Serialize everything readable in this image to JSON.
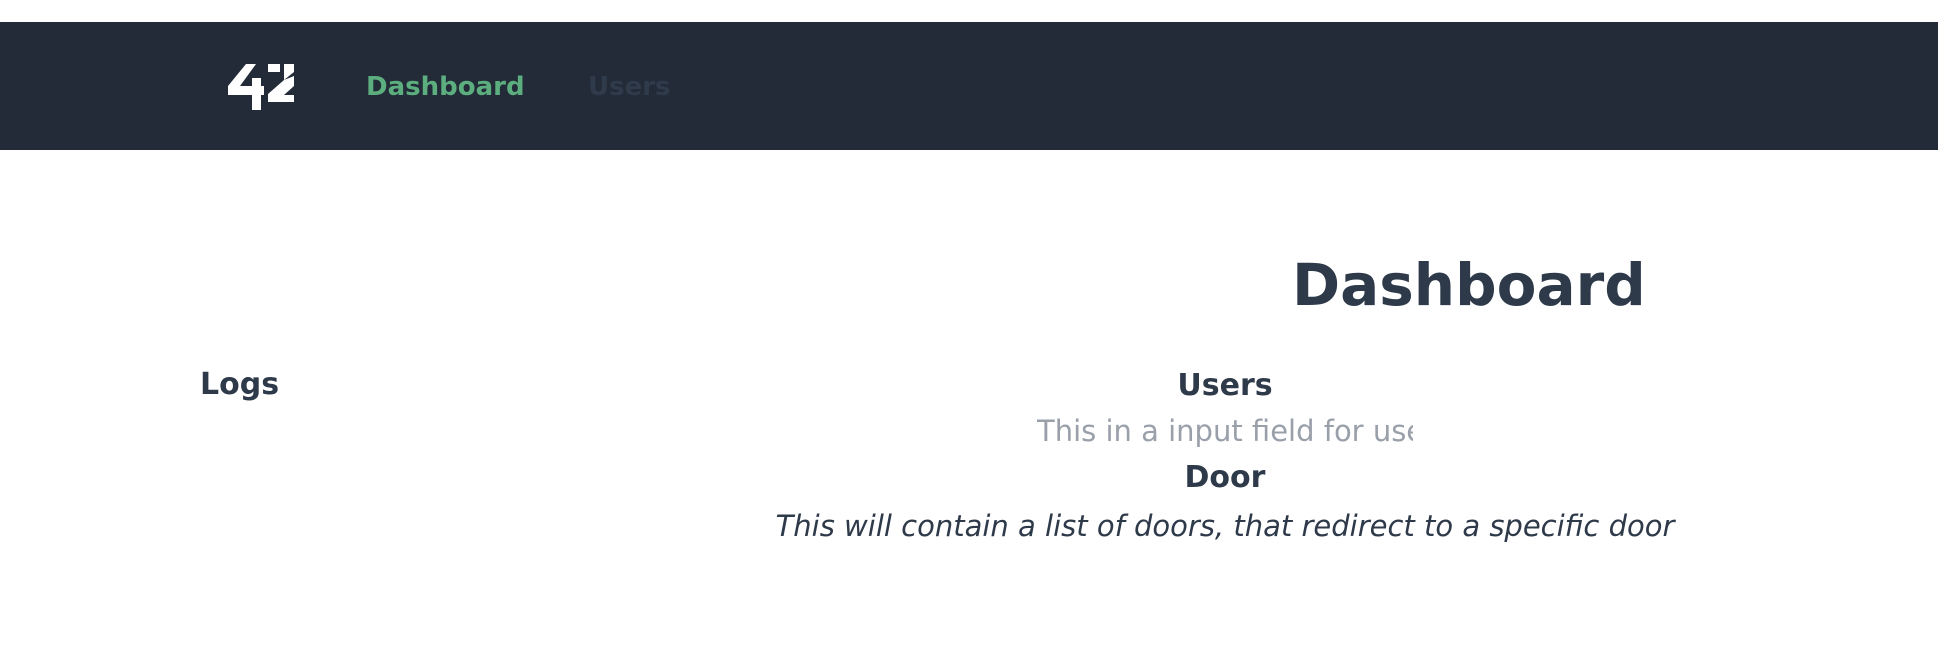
{
  "nav": {
    "logo_text": "42",
    "links": [
      {
        "label": "Dashboard",
        "active": true,
        "color": "#5cae7f"
      },
      {
        "label": "Users",
        "active": false,
        "color": "#2f3b4b"
      }
    ],
    "background": "#222b37"
  },
  "main": {
    "title": "Dashboard",
    "logs": {
      "heading": "Logs"
    },
    "users": {
      "heading": "Users",
      "input_placeholder": "This in a input field for use"
    },
    "door": {
      "heading": "Door",
      "description": "This will contain a list of doors, that redirect to a specific door"
    }
  },
  "colors": {
    "text": "#2e3a4a",
    "placeholder": "#9aa0aa"
  }
}
